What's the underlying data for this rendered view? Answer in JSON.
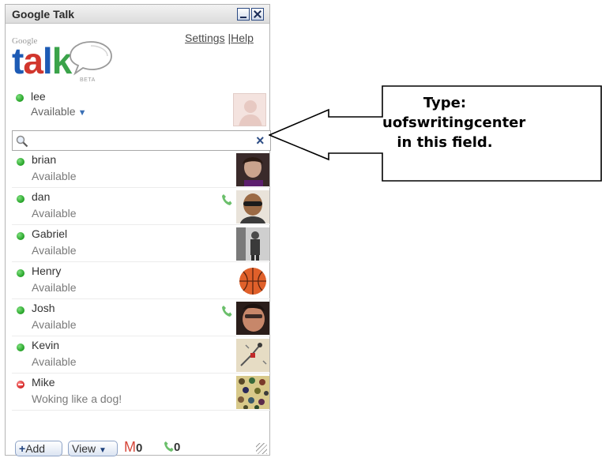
{
  "window": {
    "title": "Google Talk",
    "logo_google": "Google",
    "logo_talk": "talk",
    "logo_beta": "BETA",
    "settings_link": "Settings",
    "link_separator": "|",
    "help_link": "Help"
  },
  "self": {
    "name": "lee",
    "status": "Available"
  },
  "search": {
    "value": "",
    "clear_symbol": "×"
  },
  "contacts": [
    {
      "name": "brian",
      "status": "Available",
      "presence": "available",
      "voice": false
    },
    {
      "name": "dan",
      "status": "Available",
      "presence": "available",
      "voice": true
    },
    {
      "name": "Gabriel",
      "status": "Available",
      "presence": "available",
      "voice": false
    },
    {
      "name": "Henry",
      "status": "Available",
      "presence": "available",
      "voice": false
    },
    {
      "name": "Josh",
      "status": "Available",
      "presence": "available",
      "voice": true
    },
    {
      "name": "Kevin",
      "status": "Available",
      "presence": "available",
      "voice": false
    },
    {
      "name": "Mike",
      "status": "Woking like a dog!",
      "presence": "busy",
      "voice": false
    }
  ],
  "footer": {
    "add_label": "Add",
    "add_symbol": "+",
    "view_label": "View",
    "mail_count": "0",
    "call_count": "0"
  },
  "callout": {
    "line1": "Type:",
    "line2": "uofswritingcenter",
    "line3": "in this field."
  },
  "colors": {
    "available": "#22a024",
    "busy": "#d12020",
    "brand_blue": "#1d5bb5",
    "brand_red": "#d1362d",
    "brand_green": "#3aa34a"
  },
  "icons": [
    "minimize-icon",
    "close-icon",
    "search-icon",
    "clear-icon",
    "phone-icon",
    "mail-icon",
    "resize-grip-icon",
    "callout-arrow"
  ]
}
